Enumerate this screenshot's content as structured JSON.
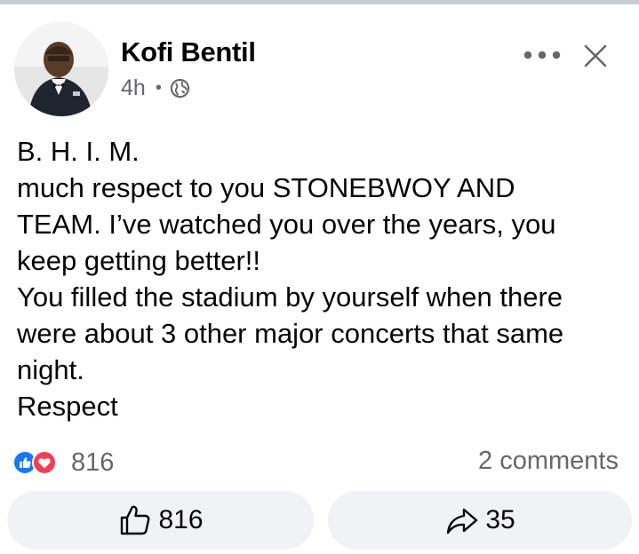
{
  "post": {
    "author_name": "Kofi Bentil",
    "time_ago": "4h",
    "separator": "•",
    "privacy_icon": "globe-icon",
    "more_icon": "more-horizontal-icon",
    "close_icon": "close-icon",
    "text_lines": [
      "B. H. I. M.",
      "much respect to you STONEBWOY AND",
      "TEAM. I’ve watched you over the years, you",
      "keep getting better!!",
      "You filled the stadium by yourself when there",
      "were about 3 other major concerts that same",
      "night.",
      "Respect"
    ]
  },
  "stats": {
    "reaction_icons": [
      "like-icon",
      "love-icon"
    ],
    "reaction_count": "816",
    "comments": "2 comments"
  },
  "actions": {
    "like_count": "816",
    "share_count": "35"
  },
  "colors": {
    "like_blue": "#1877f2",
    "love_red": "#f33e58",
    "muted_text": "#65676b",
    "button_bg": "#f0f2f5"
  }
}
